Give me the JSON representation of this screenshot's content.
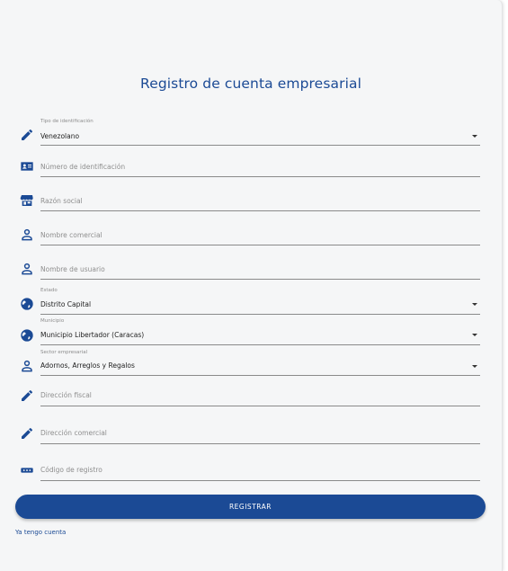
{
  "form": {
    "title": "Registro de cuenta empresarial",
    "fields": [
      {
        "label": "Tipo de identificación",
        "value": "Venezolano",
        "icon": "pencil-icon"
      },
      {
        "placeholder": "Número de identificación",
        "icon": "id-card-icon"
      },
      {
        "placeholder": "Razón social",
        "icon": "storefront-icon"
      },
      {
        "placeholder": "Nombre comercial",
        "icon": "person-icon"
      },
      {
        "placeholder": "Nombre de usuario",
        "icon": "person-icon"
      },
      {
        "label": "Estado",
        "value": "Distrito Capital",
        "icon": "globe-icon"
      },
      {
        "label": "Municipio",
        "value": "Municipio Libertador (Caracas)",
        "icon": "globe-icon"
      },
      {
        "label": "Sector empresarial",
        "value": "Adornos, Arreglos y Regalos",
        "icon": "person-icon"
      },
      {
        "placeholder": "Dirección fiscal",
        "icon": "pencil-icon"
      },
      {
        "placeholder": "Dirección comercial",
        "icon": "pencil-icon"
      },
      {
        "placeholder": "Código de registro",
        "icon": "password-icon"
      }
    ],
    "submit_label": "REGISTRAR",
    "login_link": "Ya tengo cuenta"
  },
  "colors": {
    "accent": "#1b4a95",
    "background": "#f5f6f7"
  }
}
